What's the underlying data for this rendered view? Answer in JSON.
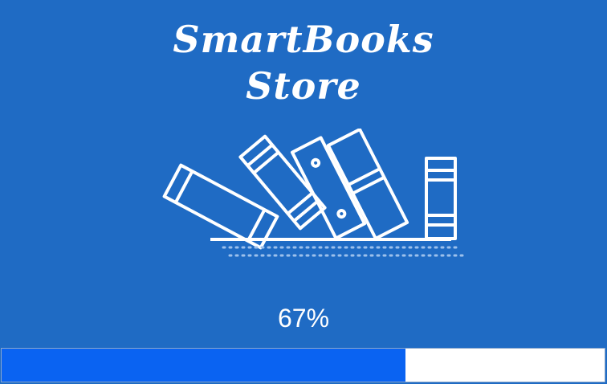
{
  "app": {
    "title_line1": "SmartBooks",
    "title_line2": "Store"
  },
  "loading": {
    "percent_label": "67%",
    "progress": 0.67
  },
  "colors": {
    "background": "#1f6bc4",
    "progress_fill": "#0a63f2",
    "progress_track": "#ffffff",
    "foreground": "#ffffff"
  },
  "icons": {
    "illustration": "books-on-shelf-icon"
  }
}
